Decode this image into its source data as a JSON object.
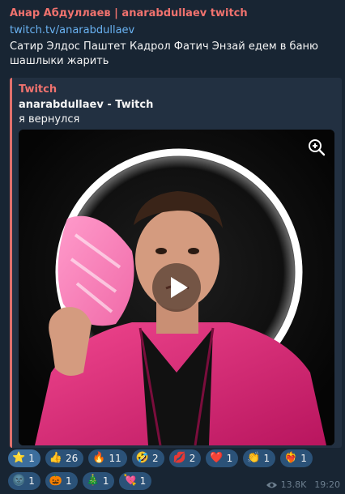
{
  "message": {
    "author": "Анар Абдуллаев | anarabdullaev twitch",
    "link": "twitch.tv/anarabdullaev",
    "text": "Сатир Элдос Паштет Кадрол Фатич Энзай едем в баню шашлыки жарить"
  },
  "preview": {
    "site": "Twitch",
    "title": "anarabdullaev - Twitch",
    "description": "я вернулся"
  },
  "colors": {
    "accent": "#f0726e",
    "link": "#6ab3f3",
    "bubble": "#182533",
    "reaction_bg": "#2b5278",
    "neon_ring": "#ffffff",
    "jacket": "#e0357f"
  },
  "reactions": [
    {
      "emoji": "⭐",
      "icon": "star-icon",
      "count": "1"
    },
    {
      "emoji": "👍",
      "icon": "thumbs-up-icon",
      "count": "26"
    },
    {
      "emoji": "🔥",
      "icon": "fire-icon",
      "count": "11"
    },
    {
      "emoji": "🤣",
      "icon": "rofl-icon",
      "count": "2"
    },
    {
      "emoji": "💋",
      "icon": "kiss-icon",
      "count": "2"
    },
    {
      "emoji": "❤️",
      "icon": "heart-icon",
      "count": "1"
    },
    {
      "emoji": "👏",
      "icon": "clap-icon",
      "count": "1"
    },
    {
      "emoji": "❤️‍🔥",
      "icon": "heart-on-fire-icon",
      "count": "1"
    },
    {
      "emoji": "🌚",
      "icon": "new-moon-face-icon",
      "count": "1"
    },
    {
      "emoji": "🎃",
      "icon": "pumpkin-icon",
      "count": "1"
    },
    {
      "emoji": "🎄",
      "icon": "christmas-tree-icon",
      "count": "1"
    },
    {
      "emoji": "💘",
      "icon": "heart-arrow-icon",
      "count": "1"
    }
  ],
  "meta": {
    "views": "13.8K",
    "time": "19:20",
    "views_icon": "eye-icon"
  }
}
